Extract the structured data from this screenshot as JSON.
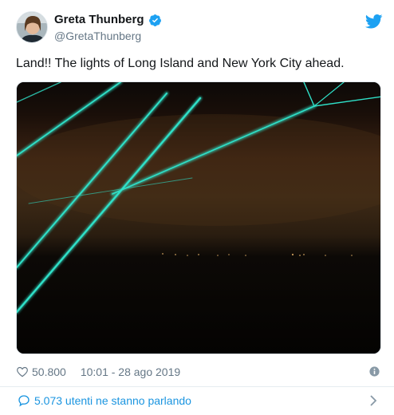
{
  "author": {
    "display_name": "Greta Thunberg",
    "handle": "@GretaThunberg",
    "verified": true
  },
  "tweet": {
    "text": "Land!! The lights of Long Island and New York City ahead."
  },
  "media": {
    "type": "photo",
    "description_icon": "night-sea-photo"
  },
  "meta": {
    "likes": "50.800",
    "timestamp": "10:01 - 28 ago 2019"
  },
  "conversation": {
    "label": "5.073 utenti ne stanno parlando"
  },
  "icons": {
    "heart": "heart-icon",
    "info": "info-icon",
    "bird": "twitter-bird-icon",
    "verified": "verified-badge-icon",
    "bubble": "speech-bubble-icon",
    "chevron": "chevron-right-icon"
  },
  "colors": {
    "brand": "#1da1f2",
    "link": "#1b95e0",
    "secondary_text": "#657786",
    "primary_text": "#14171a",
    "rope_glow": "#2fe0c8"
  }
}
